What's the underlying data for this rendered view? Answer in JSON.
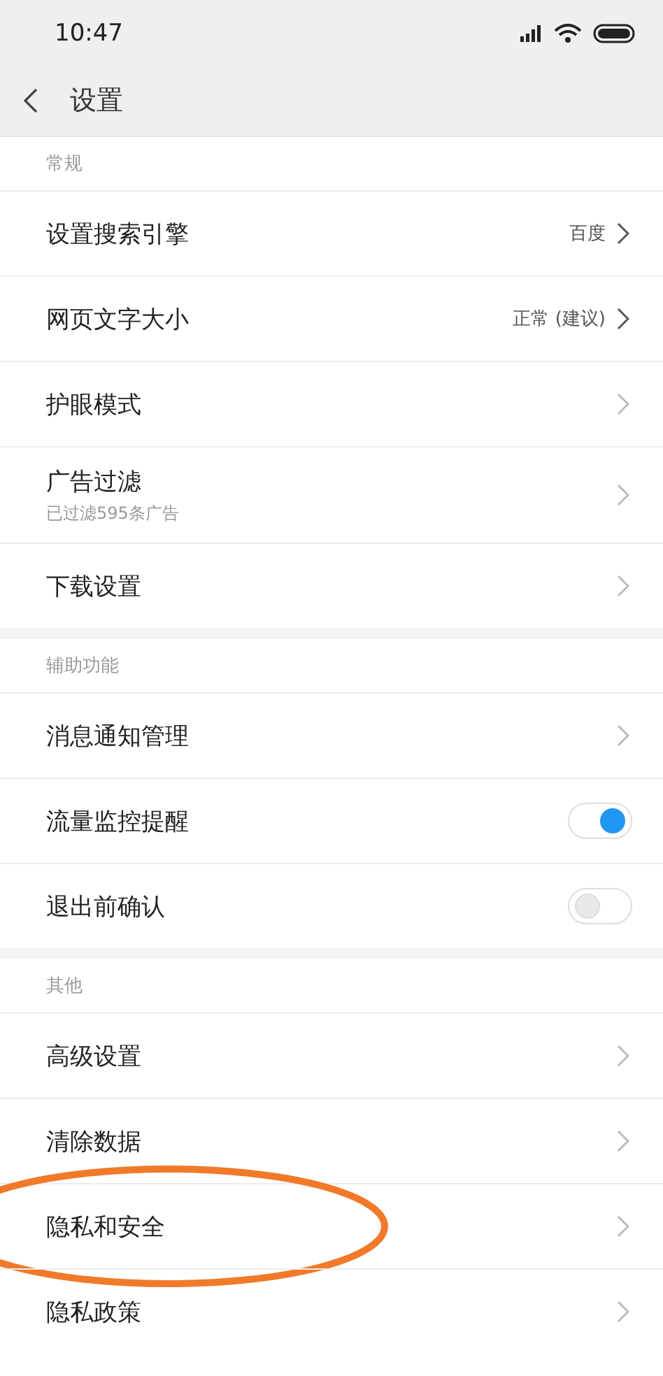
{
  "status_bar": {
    "time": "10:47"
  },
  "header": {
    "title": "设置"
  },
  "sections": [
    {
      "title": "常规",
      "rows": [
        {
          "kind": "link",
          "label": "设置搜索引擎",
          "value": "百度"
        },
        {
          "kind": "link",
          "label": "网页文字大小",
          "value": "正常 (建议)"
        },
        {
          "kind": "link",
          "label": "护眼模式"
        },
        {
          "kind": "link",
          "label": "广告过滤",
          "subtitle": "已过滤595条广告"
        },
        {
          "kind": "link",
          "label": "下载设置"
        }
      ]
    },
    {
      "title": "辅助功能",
      "rows": [
        {
          "kind": "link",
          "label": "消息通知管理"
        },
        {
          "kind": "toggle",
          "label": "流量监控提醒",
          "on": true
        },
        {
          "kind": "toggle",
          "label": "退出前确认",
          "on": false
        }
      ]
    },
    {
      "title": "其他",
      "rows": [
        {
          "kind": "link",
          "label": "高级设置"
        },
        {
          "kind": "link",
          "label": "清除数据"
        },
        {
          "kind": "link",
          "label": "隐私和安全",
          "circled": true
        },
        {
          "kind": "link",
          "label": "隐私政策"
        }
      ]
    }
  ]
}
